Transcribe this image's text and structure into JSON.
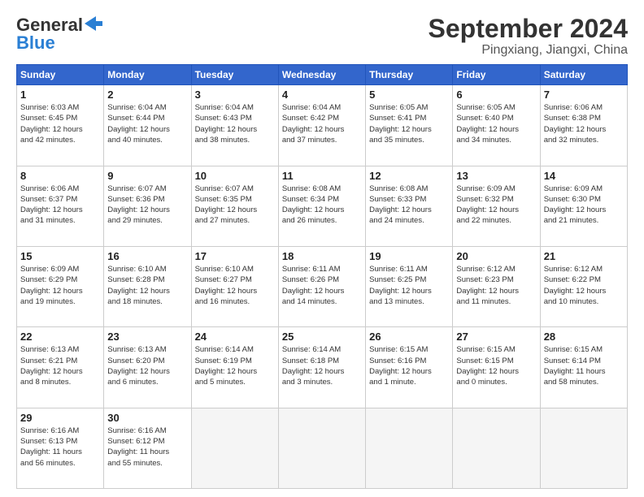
{
  "header": {
    "logo_line1": "General",
    "logo_line2": "Blue",
    "title": "September 2024",
    "subtitle": "Pingxiang, Jiangxi, China"
  },
  "days_of_week": [
    "Sunday",
    "Monday",
    "Tuesday",
    "Wednesday",
    "Thursday",
    "Friday",
    "Saturday"
  ],
  "weeks": [
    [
      {
        "day": "1",
        "info": "Sunrise: 6:03 AM\nSunset: 6:45 PM\nDaylight: 12 hours\nand 42 minutes."
      },
      {
        "day": "2",
        "info": "Sunrise: 6:04 AM\nSunset: 6:44 PM\nDaylight: 12 hours\nand 40 minutes."
      },
      {
        "day": "3",
        "info": "Sunrise: 6:04 AM\nSunset: 6:43 PM\nDaylight: 12 hours\nand 38 minutes."
      },
      {
        "day": "4",
        "info": "Sunrise: 6:04 AM\nSunset: 6:42 PM\nDaylight: 12 hours\nand 37 minutes."
      },
      {
        "day": "5",
        "info": "Sunrise: 6:05 AM\nSunset: 6:41 PM\nDaylight: 12 hours\nand 35 minutes."
      },
      {
        "day": "6",
        "info": "Sunrise: 6:05 AM\nSunset: 6:40 PM\nDaylight: 12 hours\nand 34 minutes."
      },
      {
        "day": "7",
        "info": "Sunrise: 6:06 AM\nSunset: 6:38 PM\nDaylight: 12 hours\nand 32 minutes."
      }
    ],
    [
      {
        "day": "8",
        "info": "Sunrise: 6:06 AM\nSunset: 6:37 PM\nDaylight: 12 hours\nand 31 minutes."
      },
      {
        "day": "9",
        "info": "Sunrise: 6:07 AM\nSunset: 6:36 PM\nDaylight: 12 hours\nand 29 minutes."
      },
      {
        "day": "10",
        "info": "Sunrise: 6:07 AM\nSunset: 6:35 PM\nDaylight: 12 hours\nand 27 minutes."
      },
      {
        "day": "11",
        "info": "Sunrise: 6:08 AM\nSunset: 6:34 PM\nDaylight: 12 hours\nand 26 minutes."
      },
      {
        "day": "12",
        "info": "Sunrise: 6:08 AM\nSunset: 6:33 PM\nDaylight: 12 hours\nand 24 minutes."
      },
      {
        "day": "13",
        "info": "Sunrise: 6:09 AM\nSunset: 6:32 PM\nDaylight: 12 hours\nand 22 minutes."
      },
      {
        "day": "14",
        "info": "Sunrise: 6:09 AM\nSunset: 6:30 PM\nDaylight: 12 hours\nand 21 minutes."
      }
    ],
    [
      {
        "day": "15",
        "info": "Sunrise: 6:09 AM\nSunset: 6:29 PM\nDaylight: 12 hours\nand 19 minutes."
      },
      {
        "day": "16",
        "info": "Sunrise: 6:10 AM\nSunset: 6:28 PM\nDaylight: 12 hours\nand 18 minutes."
      },
      {
        "day": "17",
        "info": "Sunrise: 6:10 AM\nSunset: 6:27 PM\nDaylight: 12 hours\nand 16 minutes."
      },
      {
        "day": "18",
        "info": "Sunrise: 6:11 AM\nSunset: 6:26 PM\nDaylight: 12 hours\nand 14 minutes."
      },
      {
        "day": "19",
        "info": "Sunrise: 6:11 AM\nSunset: 6:25 PM\nDaylight: 12 hours\nand 13 minutes."
      },
      {
        "day": "20",
        "info": "Sunrise: 6:12 AM\nSunset: 6:23 PM\nDaylight: 12 hours\nand 11 minutes."
      },
      {
        "day": "21",
        "info": "Sunrise: 6:12 AM\nSunset: 6:22 PM\nDaylight: 12 hours\nand 10 minutes."
      }
    ],
    [
      {
        "day": "22",
        "info": "Sunrise: 6:13 AM\nSunset: 6:21 PM\nDaylight: 12 hours\nand 8 minutes."
      },
      {
        "day": "23",
        "info": "Sunrise: 6:13 AM\nSunset: 6:20 PM\nDaylight: 12 hours\nand 6 minutes."
      },
      {
        "day": "24",
        "info": "Sunrise: 6:14 AM\nSunset: 6:19 PM\nDaylight: 12 hours\nand 5 minutes."
      },
      {
        "day": "25",
        "info": "Sunrise: 6:14 AM\nSunset: 6:18 PM\nDaylight: 12 hours\nand 3 minutes."
      },
      {
        "day": "26",
        "info": "Sunrise: 6:15 AM\nSunset: 6:16 PM\nDaylight: 12 hours\nand 1 minute."
      },
      {
        "day": "27",
        "info": "Sunrise: 6:15 AM\nSunset: 6:15 PM\nDaylight: 12 hours\nand 0 minutes."
      },
      {
        "day": "28",
        "info": "Sunrise: 6:15 AM\nSunset: 6:14 PM\nDaylight: 11 hours\nand 58 minutes."
      }
    ],
    [
      {
        "day": "29",
        "info": "Sunrise: 6:16 AM\nSunset: 6:13 PM\nDaylight: 11 hours\nand 56 minutes."
      },
      {
        "day": "30",
        "info": "Sunrise: 6:16 AM\nSunset: 6:12 PM\nDaylight: 11 hours\nand 55 minutes."
      },
      {
        "day": "",
        "info": ""
      },
      {
        "day": "",
        "info": ""
      },
      {
        "day": "",
        "info": ""
      },
      {
        "day": "",
        "info": ""
      },
      {
        "day": "",
        "info": ""
      }
    ]
  ]
}
